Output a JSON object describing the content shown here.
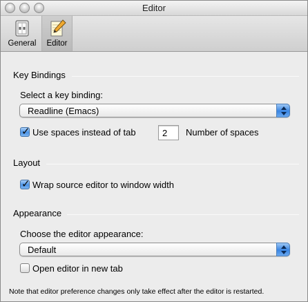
{
  "window": {
    "title": "Editor"
  },
  "toolbar": {
    "items": [
      {
        "label": "General",
        "icon": "phone-switch-icon"
      },
      {
        "label": "Editor",
        "icon": "pencil-notepad-icon",
        "selected": true
      }
    ]
  },
  "key_bindings": {
    "heading": "Key Bindings",
    "select_label": "Select a key binding:",
    "popup_value": "Readline (Emacs)",
    "use_spaces_label": "Use spaces instead of tab",
    "use_spaces_checked": true,
    "num_spaces_value": "2",
    "num_spaces_label": "Number of spaces"
  },
  "layout": {
    "heading": "Layout",
    "wrap_label": "Wrap source editor to window width",
    "wrap_checked": true
  },
  "appearance": {
    "heading": "Appearance",
    "choose_label": "Choose the editor appearance:",
    "popup_value": "Default",
    "open_new_tab_label": "Open editor in new tab",
    "open_new_tab_checked": false
  },
  "footer": {
    "note": "Note that editor preference changes only take effect after the editor is restarted."
  },
  "colors": {
    "accent": "#3a86e3"
  }
}
